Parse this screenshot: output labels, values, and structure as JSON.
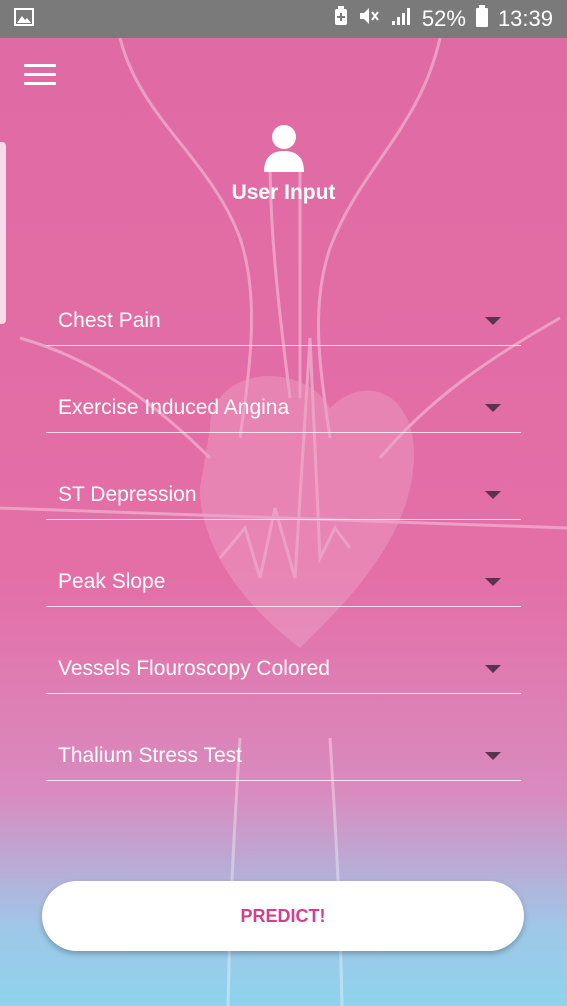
{
  "status_bar": {
    "battery": "52%",
    "time": "13:39",
    "icons": [
      "gallery-icon",
      "battery-saver-icon",
      "mute-icon",
      "signal-icon",
      "battery-icon"
    ]
  },
  "header": {
    "title": "User Input",
    "icon": "user-icon"
  },
  "menu": {
    "icon": "hamburger-menu-icon"
  },
  "fields": [
    {
      "label": "Chest Pain"
    },
    {
      "label": "Exercise Induced Angina"
    },
    {
      "label": "ST Depression"
    },
    {
      "label": "Peak Slope"
    },
    {
      "label": "Vessels Flouroscopy Colored"
    },
    {
      "label": "Thalium Stress Test"
    }
  ],
  "predict_button": {
    "label": "PREDICT!"
  },
  "colors": {
    "background_top": "#e06aa3",
    "background_bottom": "#8fd3ec",
    "button_text": "#d23f8b",
    "status_bar": "#7a7a7a"
  }
}
